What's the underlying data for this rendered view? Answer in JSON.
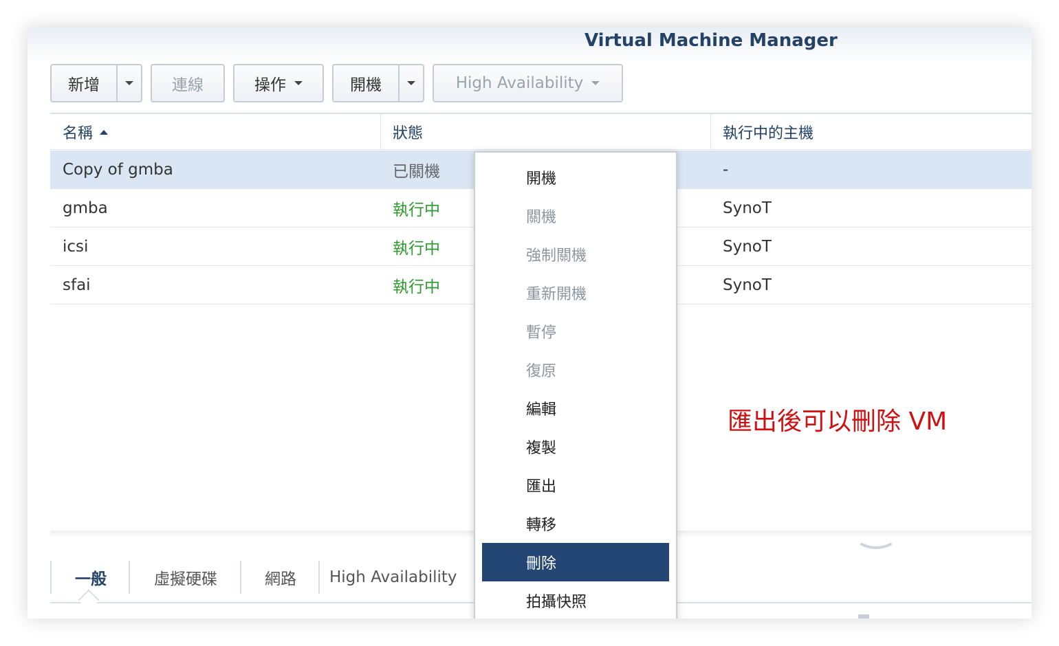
{
  "app": {
    "title": "Virtual Machine Manager"
  },
  "toolbar": {
    "add_label": "新增",
    "connect_label": "連線",
    "action_label": "操作",
    "power_on_label": "開機",
    "ha_label": "High Availability"
  },
  "grid": {
    "columns": [
      "名稱",
      "狀態",
      "執行中的主機"
    ],
    "rows": [
      {
        "name": "Copy of gmba",
        "status": "已關機",
        "host": "-"
      },
      {
        "name": "gmba",
        "status": "執行中",
        "host": "SynoT"
      },
      {
        "name": "icsi",
        "status": "執行中",
        "host": "SynoT"
      },
      {
        "name": "sfai",
        "status": "執行中",
        "host": "SynoT"
      }
    ]
  },
  "context_menu": {
    "items": [
      {
        "label": "開機",
        "state": "enabled"
      },
      {
        "label": "關機",
        "state": "disabled"
      },
      {
        "label": "強制關機",
        "state": "disabled"
      },
      {
        "label": "重新開機",
        "state": "disabled"
      },
      {
        "label": "暫停",
        "state": "disabled"
      },
      {
        "label": "復原",
        "state": "disabled"
      },
      {
        "label": "編輯",
        "state": "enabled"
      },
      {
        "label": "複製",
        "state": "enabled"
      },
      {
        "label": "匯出",
        "state": "enabled"
      },
      {
        "label": "轉移",
        "state": "enabled"
      },
      {
        "label": "刪除",
        "state": "highlighted"
      },
      {
        "label": "拍攝快照",
        "state": "enabled"
      }
    ]
  },
  "annotation": {
    "text": "匯出後可以刪除 VM",
    "color": "#d01010"
  },
  "detail_tabs": [
    "一般",
    "虛擬硬碟",
    "網路",
    "High Availability"
  ],
  "colors": {
    "title": "#234266",
    "selected_row": "#dae6f4",
    "status_running": "#2e9b2e",
    "menu_highlight": "#244675"
  }
}
